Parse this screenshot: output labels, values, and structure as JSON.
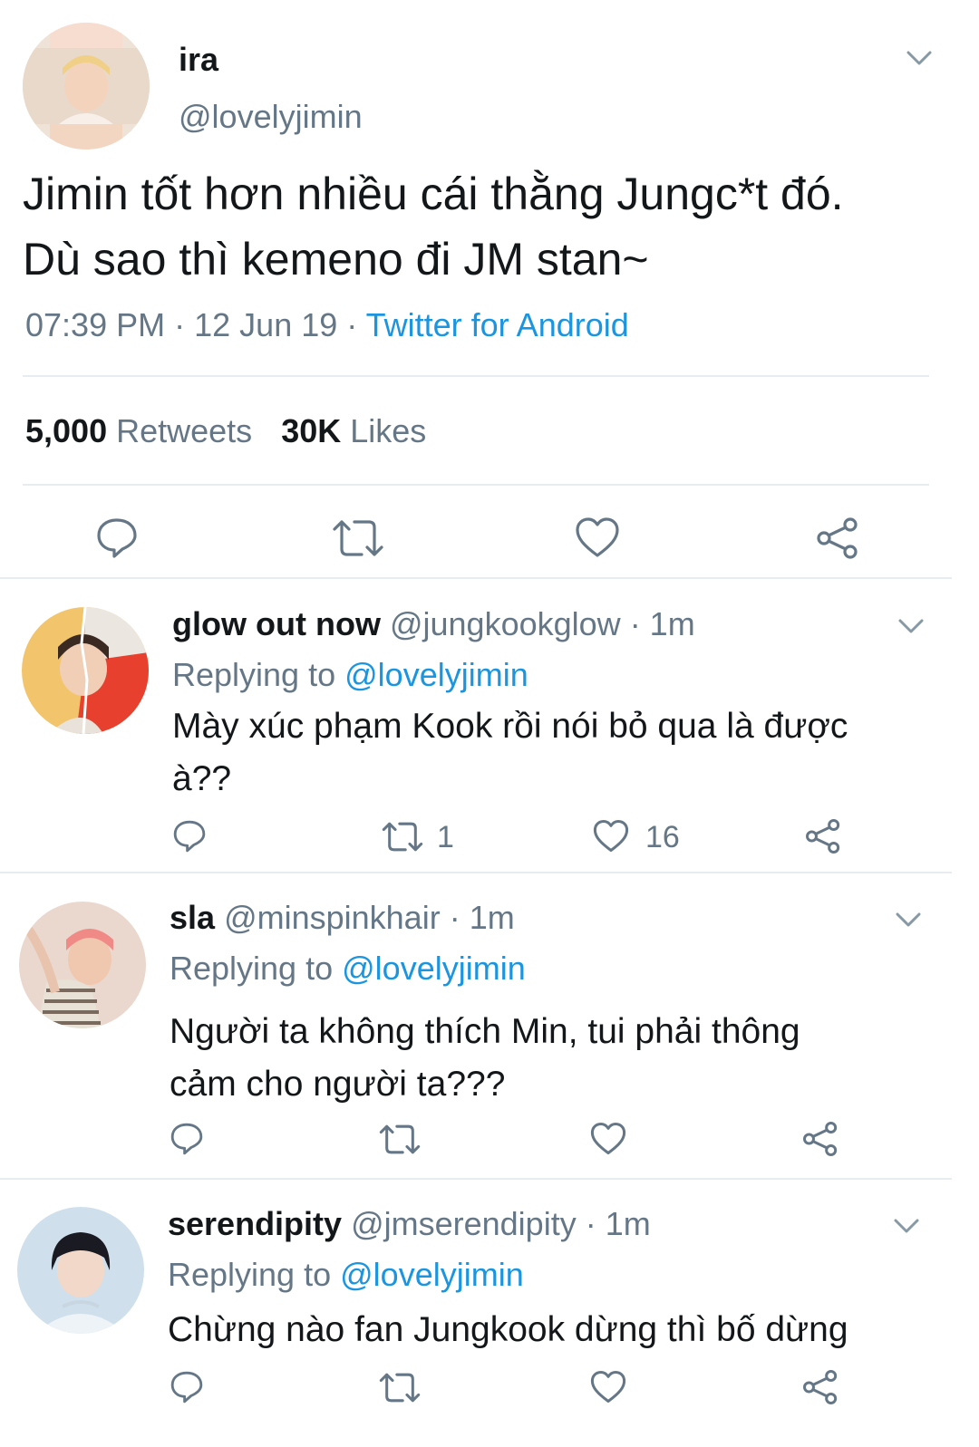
{
  "main_tweet": {
    "display_name": "ira",
    "handle": "@lovelyjimin",
    "text_line1": "Jimin tốt hơn nhiều cái thằng Jungc*t đó.",
    "text_line2": "Dù sao thì kemeno đi JM stan~",
    "time": "07:39 PM",
    "sep1": "·",
    "date": "12 Jun 19",
    "sep2": "·",
    "source": "Twitter for Android",
    "retweets_count": "5,000",
    "retweets_label": "Retweets",
    "likes_count": "30K",
    "likes_label": "Likes"
  },
  "replies": [
    {
      "display_name": "glow out now",
      "handle": "@jungkookglow",
      "time": "· 1m",
      "replying_label": "Replying to",
      "replying_handle": "@lovelyjimin",
      "text_line1": "Mày xúc phạm Kook rồi nói bỏ qua là được",
      "text_line2": "à??",
      "retweet_count": "1",
      "like_count": "16"
    },
    {
      "display_name": "sla",
      "handle": "@minspinkhair",
      "time": "· 1m",
      "replying_label": "Replying to",
      "replying_handle": "@lovelyjimin",
      "text_line1": "Người ta không thích Min, tui phải thông",
      "text_line2": "cảm cho người ta???"
    },
    {
      "display_name": "serendipity",
      "handle": "@jmserendipity",
      "time": "· 1m",
      "replying_label": "Replying to",
      "replying_handle": "@lovelyjimin",
      "text_line1": "Chừng nào fan Jungkook dừng thì bố dừng"
    }
  ],
  "colors": {
    "text": "#14171a",
    "secondary": "#657786",
    "link": "#1b95e0",
    "divider": "#e6ecf0"
  }
}
